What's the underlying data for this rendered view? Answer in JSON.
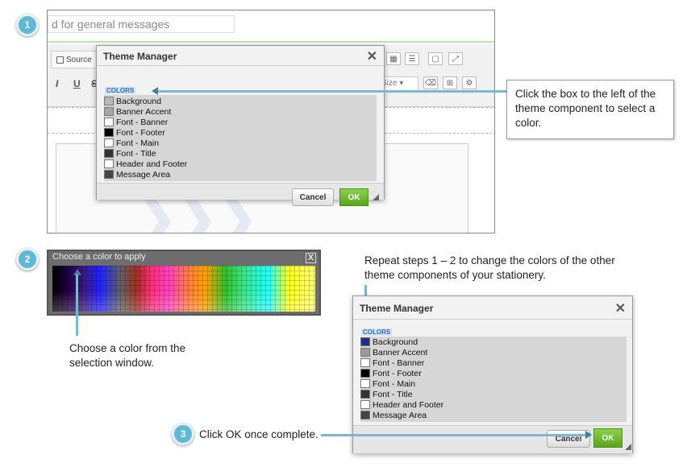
{
  "steps": [
    "1",
    "2",
    "3"
  ],
  "shot1": {
    "input_text": "d for general messages",
    "source_label": "Source",
    "format_buttons": [
      "I",
      "U",
      "S"
    ],
    "size_label": "Size",
    "dialog": {
      "title": "Theme Manager",
      "close": "✕",
      "section": "COLORS",
      "items": [
        "Background",
        "Banner Accent",
        "Font - Banner",
        "Font - Footer",
        "Font - Main",
        "Font - Title",
        "Header and Footer",
        "Message Area"
      ],
      "swatches": [
        "#b8b8b8",
        "#a5a5a5",
        "#ffffff",
        "#000000",
        "#ffffff",
        "#333333",
        "#ffffff",
        "#444444"
      ],
      "cancel": "Cancel",
      "ok": "OK"
    }
  },
  "callout1": "Click the box to the left of the theme component to select a color.",
  "picker": {
    "title": "Choose a color to apply",
    "close": "X"
  },
  "note2": "Choose a color from the selection window.",
  "note_repeat": "Repeat steps 1 – 2 to change the colors of the other theme components of your stationery.",
  "shot2": {
    "title": "Theme Manager",
    "close": "✕",
    "section": "COLORS",
    "items": [
      "Background",
      "Banner Accent",
      "Font - Banner",
      "Font - Footer",
      "Font - Main",
      "Font - Title",
      "Header and Footer",
      "Message Area"
    ],
    "swatches": [
      "#1f2f80",
      "#9a9a9a",
      "#ffffff",
      "#000000",
      "#ffffff",
      "#333333",
      "#ffffff",
      "#444444"
    ],
    "cancel": "Cancel",
    "ok": "OK"
  },
  "note3": "Click OK once complete.",
  "colors": {
    "accent": "#5fb8d6",
    "ok_green": "#6cbf2c",
    "arrow": "#3e82a3"
  }
}
